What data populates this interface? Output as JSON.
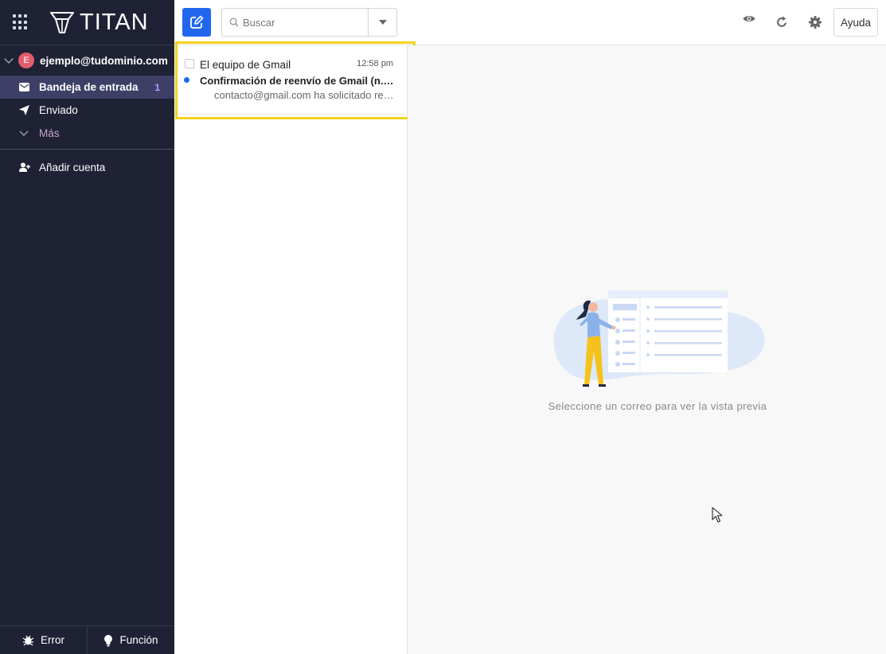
{
  "app": {
    "brand": "TITAN"
  },
  "sidebar": {
    "account": {
      "initial": "E",
      "email": "ejemplo@tudominio.com",
      "avatar_color": "#e35d6a"
    },
    "folders": [
      {
        "label": "Bandeja de entrada",
        "count": "1",
        "icon": "envelope-icon",
        "active": true
      },
      {
        "label": "Enviado",
        "icon": "paper-plane-icon"
      },
      {
        "label": "Más",
        "icon": "chevron-down-icon"
      }
    ],
    "add_account": "Añadir cuenta",
    "footer": {
      "bug_label": "Error",
      "feature_label": "Función"
    }
  },
  "toolbar": {
    "search_placeholder": "Buscar",
    "help_label": "Ayuda",
    "accent_color": "#2167ee"
  },
  "messages": [
    {
      "sender": "El equipo de Gmail",
      "time": "12:58 pm",
      "subject": "Confirmación de reenvío de Gmail (n.º 92...",
      "preview": "contacto@gmail.com ha solicitado ree...",
      "unread": true
    }
  ],
  "preview_pane": {
    "empty_message": "Seleccione un correo para ver la vista previa"
  },
  "highlight_color": "#f2d31b"
}
